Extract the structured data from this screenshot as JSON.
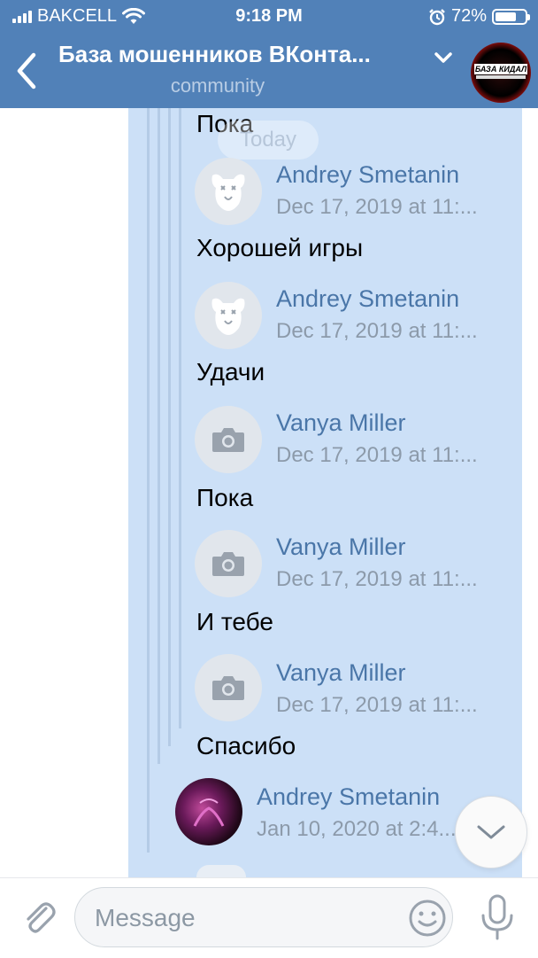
{
  "status_bar": {
    "carrier": "BAKCELL",
    "time": "9:18 PM",
    "battery": "72%",
    "battery_level": 0.72
  },
  "header": {
    "title": "База мошенников ВКонта...",
    "subtitle": "community",
    "avatar_text": "БАЗА КИДАЛ"
  },
  "chat": {
    "date_separator": "Today",
    "messages": [
      {
        "text": "Пока"
      },
      {
        "author": "Andrey Smetanin",
        "date": "Dec 17, 2019 at 11:...",
        "avatar": "deactivated-dog-icon"
      },
      {
        "text": "Хорошей игры"
      },
      {
        "author": "Andrey Smetanin",
        "date": "Dec 17, 2019 at 11:...",
        "avatar": "deactivated-dog-icon"
      },
      {
        "text": "Удачи"
      },
      {
        "author": "Vanya Miller",
        "date": "Dec 17, 2019 at 11:...",
        "avatar": "camera-icon"
      },
      {
        "text": "Пока"
      },
      {
        "author": "Vanya Miller",
        "date": "Dec 17, 2019 at 11:...",
        "avatar": "camera-icon"
      },
      {
        "text": "И тебе"
      },
      {
        "author": "Vanya Miller",
        "date": "Dec 17, 2019 at 11:...",
        "avatar": "camera-icon"
      },
      {
        "text": "Спасибо"
      },
      {
        "author": "Andrey Smetanin",
        "date": "Jan 10, 2020 at 2:4...",
        "avatar": "photo-avatar"
      }
    ]
  },
  "composer": {
    "placeholder": "Message"
  },
  "colors": {
    "header_bg": "#5181b8",
    "chat_bg": "#cce0f7",
    "link": "#4a76a8"
  }
}
